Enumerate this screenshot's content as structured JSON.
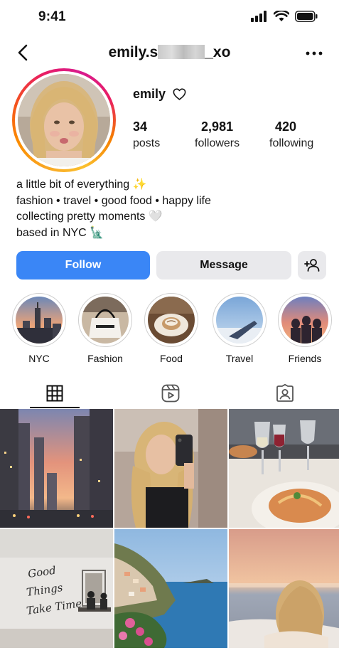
{
  "status_bar": {
    "time": "9:41",
    "icons": [
      "signal-icon",
      "wifi-icon",
      "battery-icon"
    ]
  },
  "header": {
    "username_prefix": "emily.s",
    "username_suffix": "_xo"
  },
  "profile": {
    "display_name": "emily",
    "stats": [
      {
        "value": "34",
        "label": "posts"
      },
      {
        "value": "2,981",
        "label": "followers"
      },
      {
        "value": "420",
        "label": "following"
      }
    ],
    "bio": [
      "a little bit of everything ✨",
      "fashion • travel • good food • happy life",
      "collecting pretty moments 🤍",
      "based in NYC 🗽"
    ]
  },
  "actions": {
    "follow_label": "Follow",
    "message_label": "Message"
  },
  "highlights": [
    {
      "label": "NYC"
    },
    {
      "label": "Fashion"
    },
    {
      "label": "Food"
    },
    {
      "label": "Travel"
    },
    {
      "label": "Friends"
    }
  ],
  "tabs": [
    {
      "icon": "grid-icon"
    },
    {
      "icon": "reels-icon"
    },
    {
      "icon": "tagged-icon"
    }
  ],
  "posts": [
    {
      "subject": "city-sunset"
    },
    {
      "subject": "mirror-selfie"
    },
    {
      "subject": "dinner-wine"
    },
    {
      "subject": "good-things-wall",
      "wall_text": [
        "Good",
        "Things",
        "Take Time"
      ]
    },
    {
      "subject": "coastal-village"
    },
    {
      "subject": "beach-sunset"
    }
  ],
  "colors": {
    "accent": "#3a86f6",
    "secondary_button": "#e9e9ec"
  }
}
